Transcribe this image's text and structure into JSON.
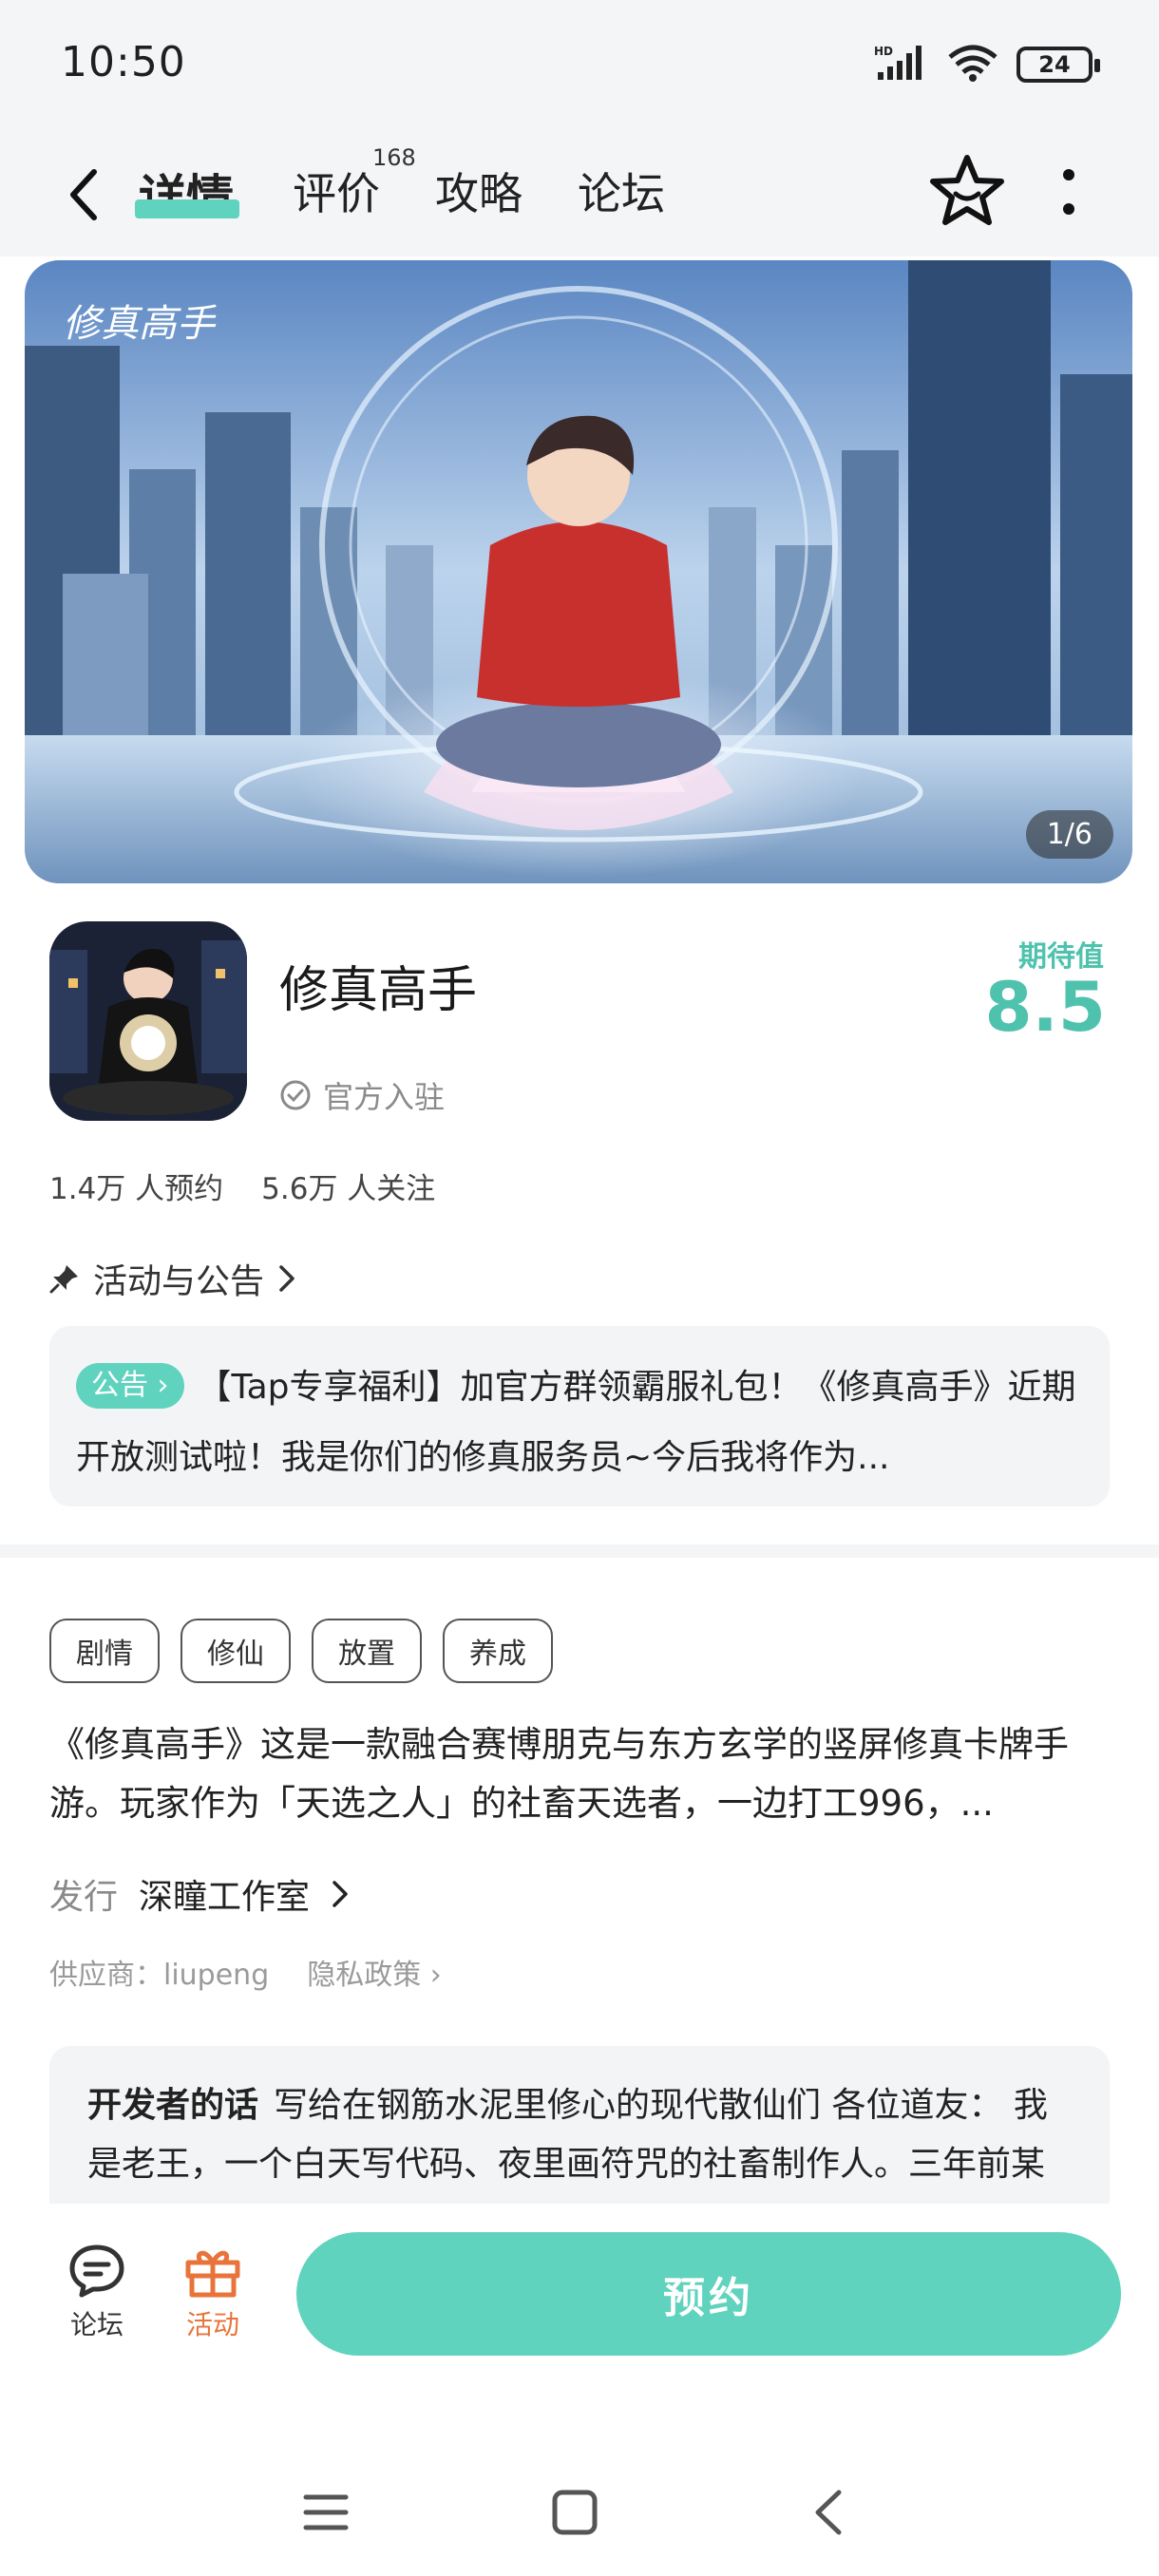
{
  "status_bar": {
    "time": "10:50",
    "network": "HD",
    "battery": "24"
  },
  "nav": {
    "tabs": [
      {
        "label": "详情",
        "active": true
      },
      {
        "label": "评价",
        "badge": "168"
      },
      {
        "label": "攻略"
      },
      {
        "label": "论坛"
      }
    ],
    "accent": "#5fd3be"
  },
  "hero": {
    "counter": "1/6",
    "logo_text": "修真高手"
  },
  "app": {
    "title": "修真高手",
    "official_label": "官方入驻",
    "expect_label": "期待值",
    "expect_value": "8.5",
    "reservations": "1.4万 人预约",
    "followers": "5.6万 人关注"
  },
  "notice": {
    "heading": "活动与公告",
    "badge": "公告",
    "text": "【Tap专享福利】加官方群领霸服礼包！《修真高手》近期开放测试啦！我是你们的修真服务员~今后我将作为..."
  },
  "tags": [
    "剧情",
    "修仙",
    "放置",
    "养成"
  ],
  "description": "《修真高手》这是一款融合赛博朋克与东方玄学的竖屏修真卡牌手游。玩家作为「天选之人」的社畜天选者，一边打工996，...",
  "publisher": {
    "label": "发行",
    "name": "深瞳工作室"
  },
  "supplier": {
    "label": "供应商：liupeng",
    "privacy": "隐私政策"
  },
  "developer_note": {
    "title": "开发者的话",
    "text": "写给在钢筋水泥里修心的现代散仙们 各位道友： 我是老王，一个白天写代码、夜里画符咒的社畜制作人。三年前某天深夜加班时，我突然想..."
  },
  "bottom_bar": {
    "forum_label": "论坛",
    "activity_label": "活动",
    "reserve_label": "预约"
  }
}
